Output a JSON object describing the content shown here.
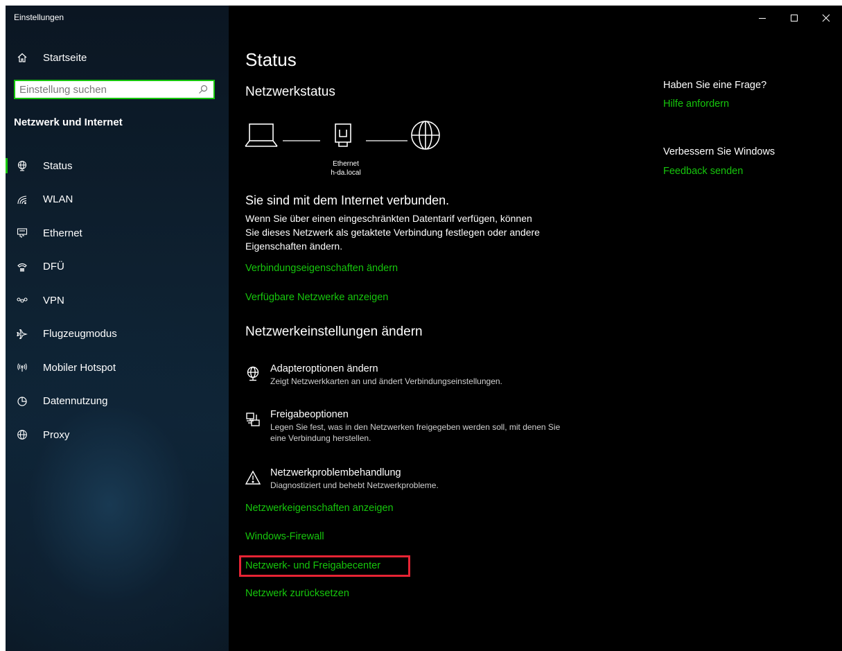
{
  "window": {
    "title": "Einstellungen"
  },
  "sidebar": {
    "home_label": "Startseite",
    "search_placeholder": "Einstellung suchen",
    "section_title": "Netzwerk und Internet",
    "items": [
      {
        "label": "Status",
        "icon": "status-globe-icon",
        "active": true
      },
      {
        "label": "WLAN",
        "icon": "wifi-icon"
      },
      {
        "label": "Ethernet",
        "icon": "ethernet-icon"
      },
      {
        "label": "DFÜ",
        "icon": "dialup-icon"
      },
      {
        "label": "VPN",
        "icon": "vpn-icon"
      },
      {
        "label": "Flugzeugmodus",
        "icon": "airplane-icon"
      },
      {
        "label": "Mobiler Hotspot",
        "icon": "hotspot-icon"
      },
      {
        "label": "Datennutzung",
        "icon": "data-usage-icon"
      },
      {
        "label": "Proxy",
        "icon": "globe-icon"
      }
    ]
  },
  "main": {
    "title": "Status",
    "network_status_title": "Netzwerkstatus",
    "adapter_name": "Ethernet",
    "adapter_domain": "h-da.local",
    "connected_text": "Sie sind mit dem Internet verbunden.",
    "description": "Wenn Sie über einen eingeschränkten Datentarif verfügen, können Sie dieses Netzwerk als getaktete Verbindung festlegen oder andere Eigenschaften ändern.",
    "link_connection_props": "Verbindungseigenschaften ändern",
    "link_available_networks": "Verfügbare Netzwerke anzeigen",
    "change_settings_title": "Netzwerkeinstellungen ändern",
    "options": [
      {
        "title": "Adapteroptionen ändern",
        "desc": "Zeigt Netzwerkkarten an und ändert Verbindungseinstellungen."
      },
      {
        "title": "Freigabeoptionen",
        "desc": "Legen Sie fest, was in den Netzwerken freigegeben werden soll, mit denen Sie eine Verbindung herstellen."
      },
      {
        "title": "Netzwerkproblembehandlung",
        "desc": "Diagnostiziert und behebt Netzwerkprobleme."
      }
    ],
    "link_network_props": "Netzwerkeigenschaften anzeigen",
    "link_firewall": "Windows-Firewall",
    "link_sharing_center": "Netzwerk- und Freigabecenter",
    "link_reset": "Netzwerk zurücksetzen"
  },
  "aside": {
    "question": "Haben Sie eine Frage?",
    "help_link": "Hilfe anfordern",
    "improve": "Verbessern Sie Windows",
    "feedback_link": "Feedback senden"
  },
  "colors": {
    "accent": "#16c60c",
    "highlight": "#e62434",
    "background": "#000000"
  }
}
